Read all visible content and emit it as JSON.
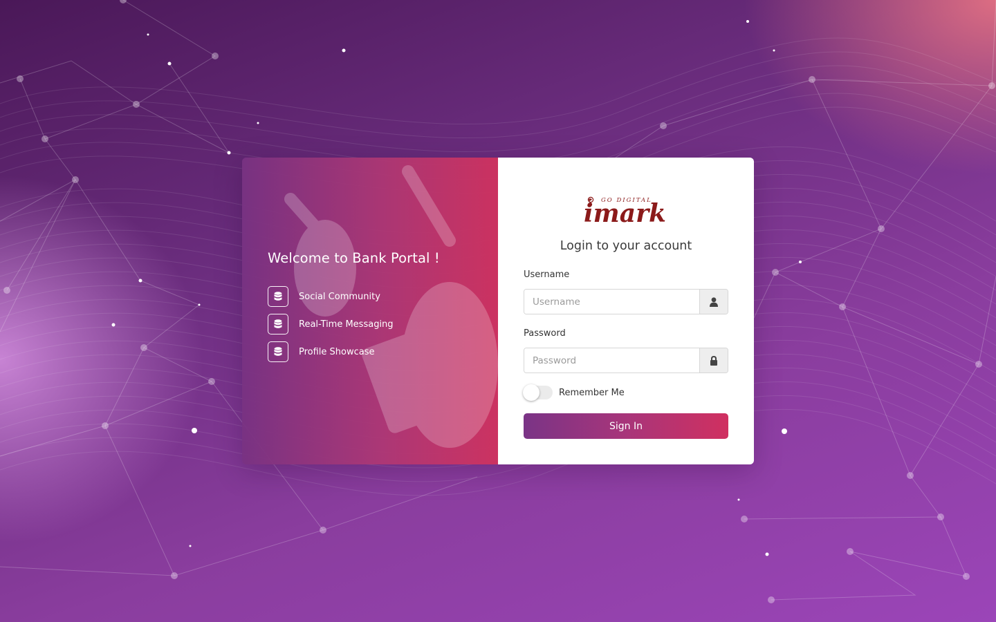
{
  "welcome_title": "Welcome to Bank Portal !",
  "features": [
    {
      "label": "Social Community",
      "icon": "database-icon"
    },
    {
      "label": "Real-Time Messaging",
      "icon": "database-icon"
    },
    {
      "label": "Profile Showcase",
      "icon": "database-icon"
    }
  ],
  "logo": {
    "tagline": "GO DIGITAL",
    "name": "imark"
  },
  "login": {
    "title": "Login to your account",
    "username_label": "Username",
    "username_placeholder": "Username",
    "username_icon": "user-icon",
    "password_label": "Password",
    "password_placeholder": "Password",
    "password_icon": "lock-icon",
    "remember_label": "Remember Me",
    "remember_checked": false,
    "signin_label": "Sign In"
  },
  "colors": {
    "gradient_start": "#7a3486",
    "gradient_end": "#d03060",
    "logo_color": "#8b1a1a",
    "background": "#6b2d7e"
  }
}
